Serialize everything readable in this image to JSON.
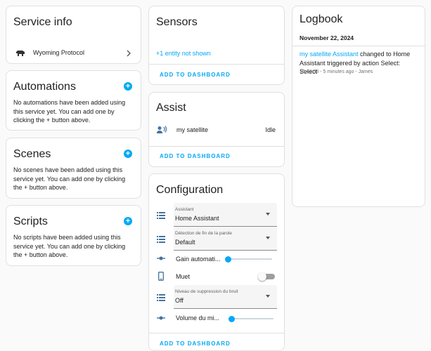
{
  "service_info": {
    "title": "Service info",
    "protocol_label": "Wyoming Protocol",
    "protocol_icon": "buffalo-icon"
  },
  "automations": {
    "title": "Automations",
    "description": "No automations have been added using this service yet. You can add one by clicking the + button above."
  },
  "scenes": {
    "title": "Scenes",
    "description": "No scenes have been added using this service yet. You can add one by clicking the + button above."
  },
  "scripts": {
    "title": "Scripts",
    "description": "No scripts have been added using this service yet. You can add one by clicking the + button above."
  },
  "sensors": {
    "title": "Sensors",
    "hidden_entities": "+1 entity not shown",
    "add_button": "ADD TO DASHBOARD"
  },
  "assist": {
    "title": "Assist",
    "entity_name": "my satellite",
    "entity_state": "Idle",
    "add_button": "ADD TO DASHBOARD"
  },
  "configuration": {
    "title": "Configuration",
    "assistant": {
      "label": "Assistant",
      "value": "Home Assistant"
    },
    "end_of_speech": {
      "label": "Détection de fin de la parole",
      "value": "Default"
    },
    "auto_gain": {
      "label": "Gain automati...",
      "value_fraction": 0.0
    },
    "mute": {
      "label": "Muet",
      "on": false
    },
    "noise_suppression": {
      "label": "Niveau de suppression du bruit",
      "value": "Off"
    },
    "volume": {
      "label": "Volume du mi...",
      "value_fraction": 0.05
    },
    "add_button": "ADD TO DASHBOARD"
  },
  "logbook": {
    "title": "Logbook",
    "date": "November 22, 2024",
    "entry_link": "my satellite Assistant",
    "entry_text": " changed to Home Assistant triggered by action Select: Select",
    "entry_meta": "16:44:58 - 5 minutes ago - James"
  },
  "colors": {
    "accent": "#03a9f4",
    "icon": "#44739e"
  }
}
